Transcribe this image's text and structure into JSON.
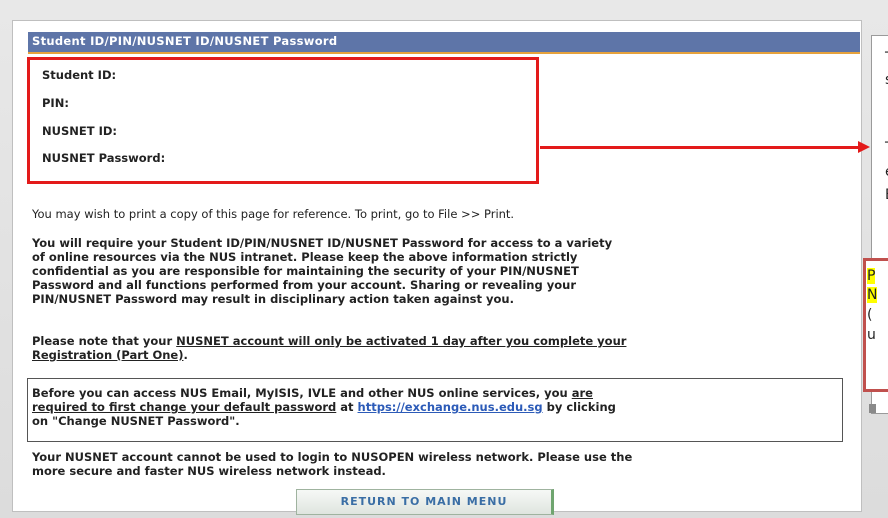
{
  "panel": {
    "header": "Student ID/PIN/NUSNET ID/NUSNET Password"
  },
  "credentials": {
    "student_id": "Student ID:",
    "pin": "PIN:",
    "nusnet_id": "NUSNET ID:",
    "nusnet_password": "NUSNET Password:"
  },
  "body": {
    "print_note": "You may wish to print a copy of this page for reference. To print, go to File >> Print.",
    "require_line1": "You will require your Student ID/PIN/NUSNET ID/NUSNET Password for access to a variety",
    "require_line2": "of online resources via the NUS intranet. Please keep the above information strictly",
    "require_line3": "confidential as you are responsible for maintaining the security of your PIN/NUSNET",
    "require_line4": "Password and all functions performed from your account. Sharing or revealing your",
    "require_line5": "PIN/NUSNET Password may result in disciplinary action taken against you.",
    "activation_pre": "Please note that your ",
    "activation_ul1": "NUSNET account will only be activated 1 day after you complete your",
    "activation_ul2": "Registration (Part One)",
    "activation_post": ".",
    "notice_l1_pre": "Before you can access NUS Email, MyISIS, IVLE and other NUS online services, you ",
    "notice_l1_ul": "are",
    "notice_l2_ul": "required to first change your default password",
    "notice_l2_mid": " at ",
    "notice_link": "https://exchange.nus.edu.sg",
    "notice_l2_post": " by clicking",
    "notice_l3": "on \"Change NUSNET Password\".",
    "wireless_l1": "Your NUSNET account cannot be used to login to NUSOPEN wireless network. Please use the",
    "wireless_l2": "more secure and faster NUS wireless network instead."
  },
  "return_button": "RETURN TO MAIN MENU",
  "callout": {
    "line1": "T",
    "line2": "s",
    "line3": "T",
    "line4": "e",
    "line5": "E",
    "note1": "P",
    "note2": "N",
    "note3": "(",
    "note4": "u"
  },
  "colors": {
    "header_bg": "#5e75a8",
    "highlight_box": "#e31a1a",
    "link": "#2c5bb8"
  }
}
